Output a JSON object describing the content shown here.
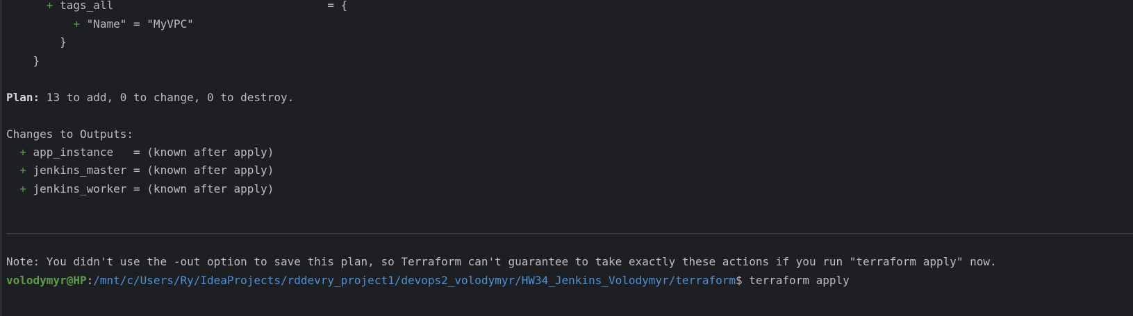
{
  "terminal": {
    "code_lines": [
      {
        "indent": "      ",
        "marker": "+",
        "text": " tags_all                                = {"
      },
      {
        "indent": "          ",
        "marker": "+",
        "text": " \"Name\" = \"MyVPC\""
      },
      {
        "indent": "        ",
        "marker": "",
        "text": "}"
      },
      {
        "indent": "    ",
        "marker": "",
        "text": "}"
      }
    ],
    "plan_label": "Plan:",
    "plan_summary": " 13 to add, 0 to change, 0 to destroy.",
    "outputs_header": "Changes to Outputs:",
    "outputs": [
      {
        "marker": "+",
        "text": " app_instance   = (known after apply)"
      },
      {
        "marker": "+",
        "text": " jenkins_master = (known after apply)"
      },
      {
        "marker": "+",
        "text": " jenkins_worker = (known after apply)"
      }
    ],
    "note": "Note: You didn't use the -out option to save this plan, so Terraform can't guarantee to take exactly these actions if you run \"terraform apply\" now.",
    "prompt": {
      "user_host": "volodymyr@HP",
      "separator": ":",
      "path": "/mnt/c/Users/Ry/IdeaProjects/rddevry_project1/devops2_volodymyr/HW34_Jenkins_Volodymyr/terraform",
      "symbol": "$",
      "command": " terraform apply"
    }
  },
  "colors": {
    "background": "#1e1f22",
    "text": "#bcbec4",
    "plus": "#5f9c48",
    "user": "#5f9c48",
    "path": "#4f92d8"
  }
}
